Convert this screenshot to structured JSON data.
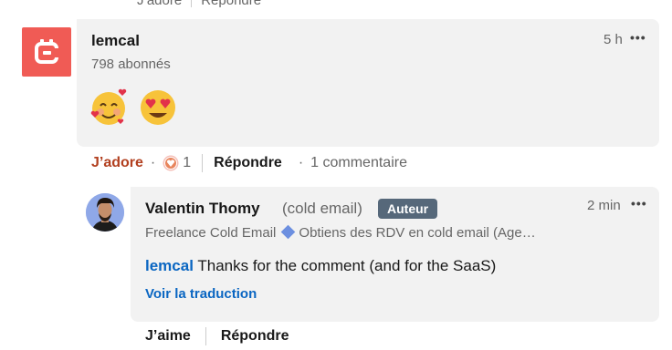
{
  "top_fragment": {
    "left": "J’adore",
    "right": "Répondre"
  },
  "post": {
    "author": "lemcal",
    "followers": "798 abonnés",
    "time": "5 h",
    "more_icon": "ellipsis-icon",
    "content_emojis": [
      "🥰",
      "😍"
    ],
    "brand_color": "#f05b55"
  },
  "post_actions": {
    "reaction_label": "J’adore",
    "reaction_separator": "·",
    "reaction_count": "1",
    "reply_label": "Répondre",
    "comments_separator": "·",
    "comments_count": "1 commentaire"
  },
  "reply": {
    "author": "Valentin Thomy",
    "pronoun": "(cold email)",
    "badge": "Auteur",
    "time": "2 min",
    "headline_left": "Freelance Cold Email",
    "headline_right": "Obtiens des RDV en cold email (Age…",
    "mention": "lemcal",
    "text": " Thanks for the comment (and for the SaaS)",
    "translate": "Voir la traduction"
  },
  "reply_actions": {
    "like_label": "J’aime",
    "reply_label": "Répondre"
  }
}
